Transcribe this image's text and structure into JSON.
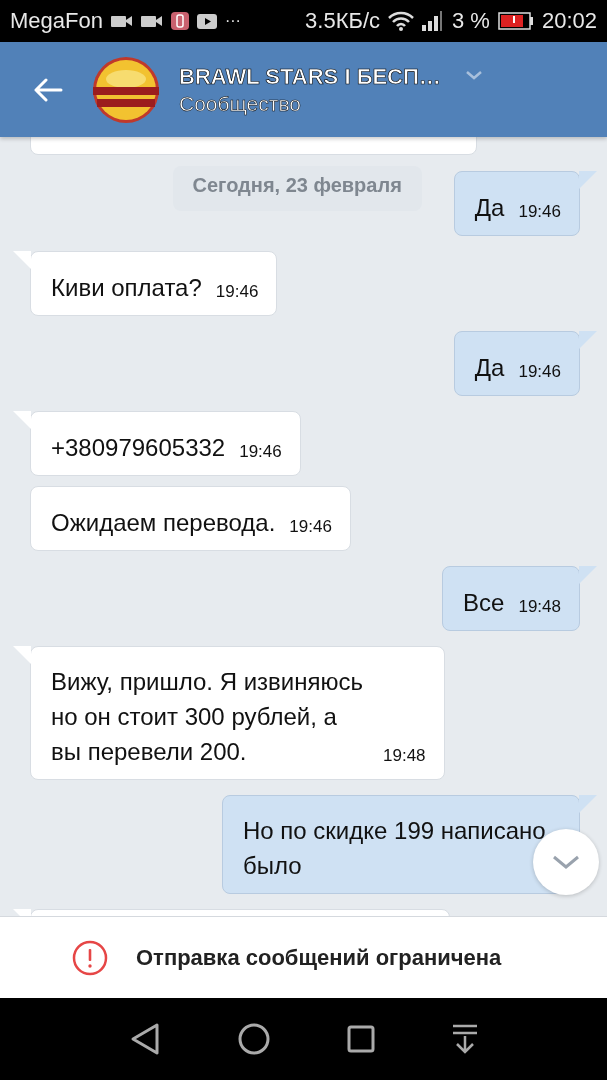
{
  "status_bar": {
    "carrier": "MegaFon",
    "more": "···",
    "speed": "3.5КБ/с",
    "battery": "3 %",
    "time": "20:02"
  },
  "header": {
    "title": "BRAWL STARS I БЕСП…",
    "subtitle": "Сообщество"
  },
  "top_partial": {
    "kind": "incoming"
  },
  "date_separator": "Сегодня, 23 февраля",
  "first_reply": {
    "kind": "outgoing",
    "tail": true,
    "text": "Да",
    "time": "19:46"
  },
  "messages": [
    {
      "kind": "incoming",
      "tail": true,
      "text": "Киви оплата?",
      "time": "19:46"
    },
    {
      "kind": "outgoing",
      "tail": true,
      "text": "Да",
      "time": "19:46"
    },
    {
      "kind": "incoming",
      "tail": true,
      "text": "+380979605332",
      "time": "19:46"
    },
    {
      "kind": "incoming",
      "tail": false,
      "text": "Ожидаем перевода.",
      "time": "19:46"
    },
    {
      "kind": "outgoing",
      "tail": true,
      "text": "Все",
      "time": "19:48"
    },
    {
      "kind": "incoming",
      "tail": true,
      "text": "Вижу, пришло. Я извиняюсь но он стоит 300 рублей, а вы перевели 200.",
      "time": "19:48"
    },
    {
      "kind": "outgoing",
      "tail": true,
      "text": "Но по скидке 199 написано было"
    },
    {
      "kind": "incoming",
      "tail": true
    }
  ],
  "restriction": "Отправка сообщений ограничена"
}
